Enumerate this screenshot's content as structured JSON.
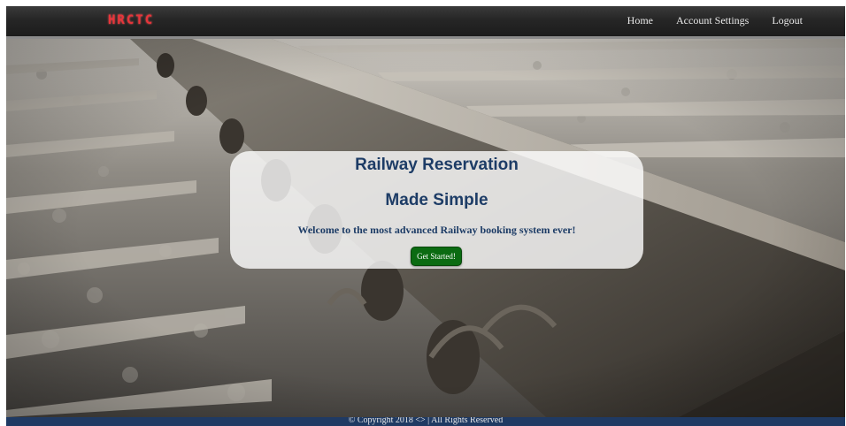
{
  "navbar": {
    "brand": "HRCTC",
    "links": [
      {
        "label": "Home"
      },
      {
        "label": "Account Settings"
      },
      {
        "label": "Logout"
      }
    ]
  },
  "hero": {
    "title": "Railway Reservation",
    "subtitle": "Made Simple",
    "tagline": "Welcome to the most advanced Railway booking system ever!",
    "cta_label": "Get Started!"
  },
  "footer": {
    "text": "© Copyright 2018 <> | All Rights Reserved"
  },
  "colors": {
    "brand_red": "#e8343a",
    "navbar_bg": "#262626",
    "heading_blue": "#1d3c66",
    "cta_green": "#0b6b12",
    "footer_bg": "#1f3a63"
  },
  "icons": {
    "background": "railway-track-photo"
  }
}
